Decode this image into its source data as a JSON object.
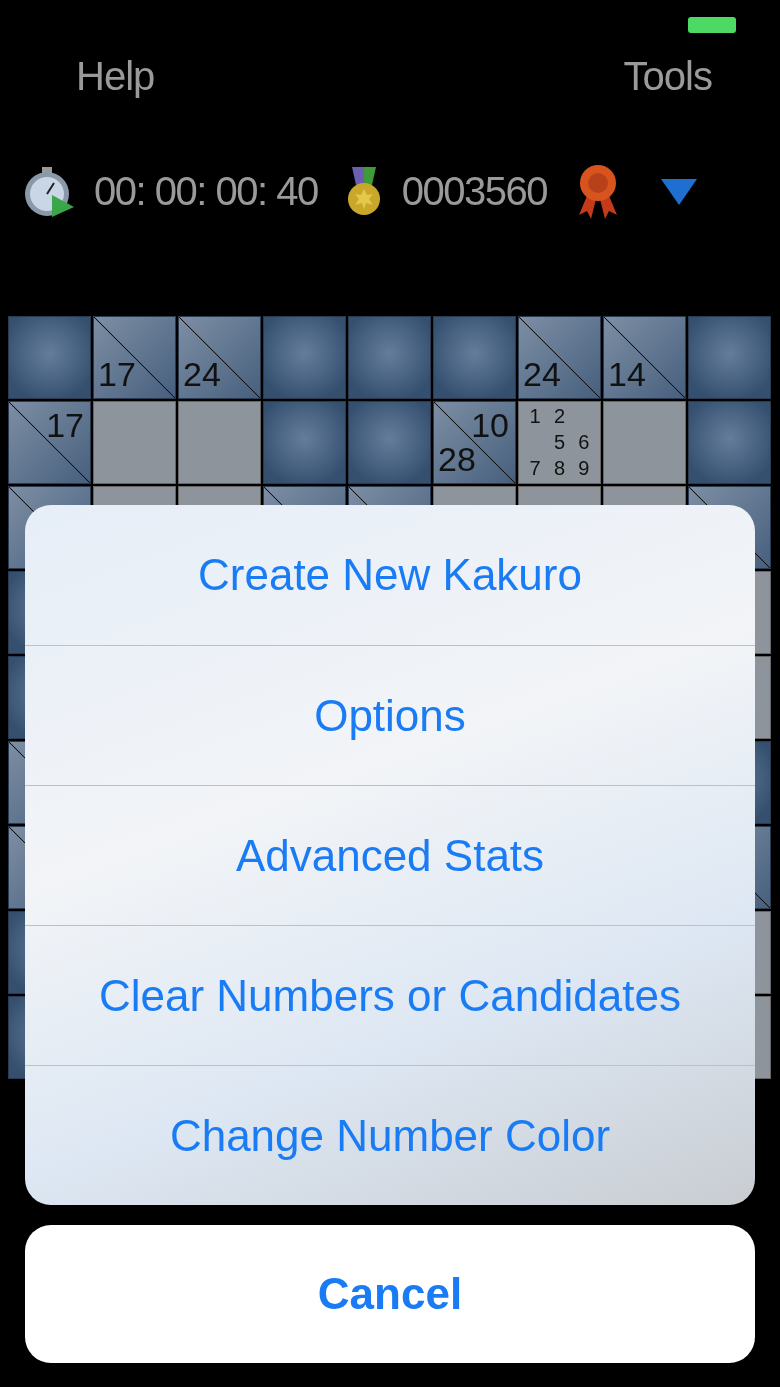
{
  "nav": {
    "left": "Help",
    "right": "Tools"
  },
  "stats": {
    "timer": "00: 00: 00: 40",
    "score": "0003560"
  },
  "grid": [
    [
      {
        "kind": "block"
      },
      {
        "kind": "clue",
        "down": "17"
      },
      {
        "kind": "clue",
        "down": "24"
      },
      {
        "kind": "block"
      },
      {
        "kind": "block"
      },
      {
        "kind": "block"
      },
      {
        "kind": "clue",
        "down": "24"
      },
      {
        "kind": "clue",
        "down": "14"
      },
      {
        "kind": "block"
      }
    ],
    [
      {
        "kind": "clue",
        "across": "17"
      },
      {
        "kind": "empty"
      },
      {
        "kind": "empty"
      },
      {
        "kind": "block"
      },
      {
        "kind": "block"
      },
      {
        "kind": "clue",
        "across": "10",
        "down": "28"
      },
      {
        "kind": "candidates",
        "slots": [
          {
            "kind": "digit",
            "digit": "1"
          },
          {
            "kind": "digit",
            "digit": "2"
          },
          {
            "kind": "gap"
          },
          {
            "kind": "gap"
          },
          {
            "kind": "digit",
            "digit": "5"
          },
          {
            "kind": "digit",
            "digit": "6"
          },
          {
            "kind": "digit",
            "digit": "7"
          },
          {
            "kind": "digit",
            "digit": "8"
          },
          {
            "kind": "digit",
            "digit": "9"
          }
        ]
      },
      {
        "kind": "empty"
      },
      {
        "kind": "block"
      }
    ],
    [
      {
        "kind": "clue"
      },
      {
        "kind": "empty"
      },
      {
        "kind": "empty"
      },
      {
        "kind": "clue"
      },
      {
        "kind": "clue"
      },
      {
        "kind": "empty"
      },
      {
        "kind": "empty"
      },
      {
        "kind": "empty"
      },
      {
        "kind": "clue"
      }
    ],
    [
      {
        "kind": "block"
      },
      {
        "kind": "empty"
      }
    ],
    [
      {
        "kind": "block"
      },
      {
        "kind": "empty"
      }
    ],
    [
      {
        "kind": "clue"
      },
      {
        "kind": "block"
      }
    ],
    [
      {
        "kind": "clue"
      },
      {
        "kind": "clue"
      }
    ],
    [
      {
        "kind": "block"
      },
      {
        "kind": "empty"
      }
    ],
    [
      {
        "kind": "block"
      },
      {
        "kind": "empty"
      }
    ]
  ],
  "action_sheet": {
    "items": [
      "Create New Kakuro",
      "Options",
      "Advanced Stats",
      "Clear Numbers or Candidates",
      "Change Number Color"
    ],
    "cancel": "Cancel"
  }
}
